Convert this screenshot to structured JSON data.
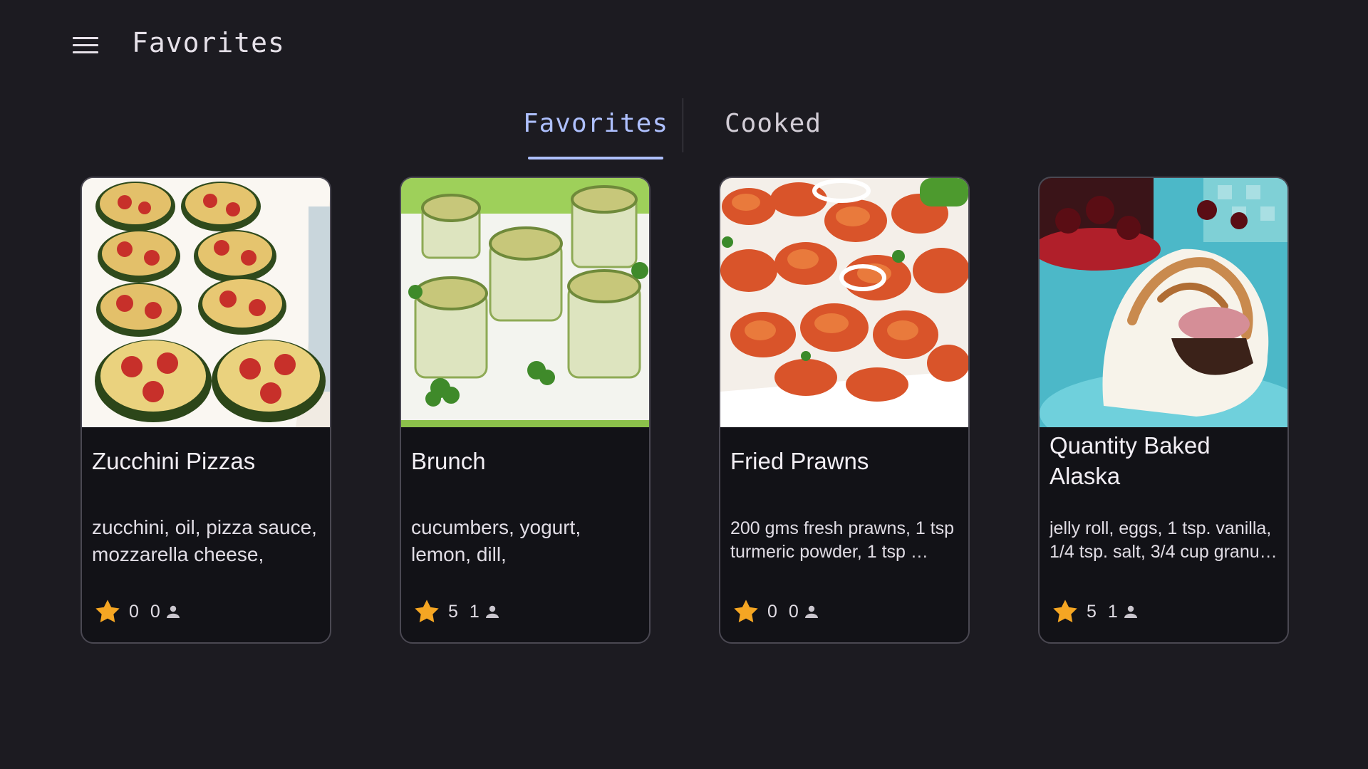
{
  "header": {
    "menu_icon": "hamburger-menu-icon",
    "title": "Favorites"
  },
  "tabs": [
    {
      "label": "Favorites",
      "selected": true
    },
    {
      "label": "Cooked",
      "selected": false
    }
  ],
  "colors": {
    "background": "#1c1b21",
    "card_background": "#121217",
    "accent": "#aec0ff",
    "star": "#f5a623"
  },
  "recipes": [
    {
      "title": "Zucchini Pizzas",
      "description": "zucchini, oil, pizza sauce, mozzarella cheese,",
      "rating": "0",
      "cooked_count": "0",
      "image": "zucchini-pizzas-photo"
    },
    {
      "title": "Brunch",
      "description": "cucumbers, yogurt, lemon, dill,",
      "rating": "5",
      "cooked_count": "1",
      "image": "cucumber-rolls-photo"
    },
    {
      "title": "Fried Prawns",
      "description": "200 gms fresh prawns, 1 tsp turmeric powder, 1 tsp …",
      "rating": "0",
      "cooked_count": "0",
      "image": "fried-prawns-photo"
    },
    {
      "title": "Quantity Baked Alaska",
      "description": "jelly roll, eggs, 1 tsp.  vanilla, 1/4 tsp. salt, 3/4 cup  granu…",
      "rating": "5",
      "cooked_count": "1",
      "image": "baked-alaska-photo"
    }
  ]
}
